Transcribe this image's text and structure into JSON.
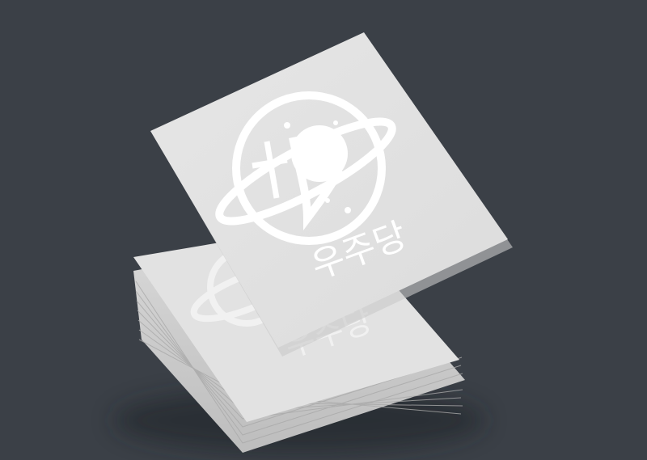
{
  "scene": {
    "background_color": "#3b4047",
    "card_color": "#e5e5e5",
    "logo_color": "#ffffff",
    "description_hidden": ""
  },
  "logo": {
    "icon": "saturn-planet-logo-icon",
    "wordmark": "우주당"
  }
}
